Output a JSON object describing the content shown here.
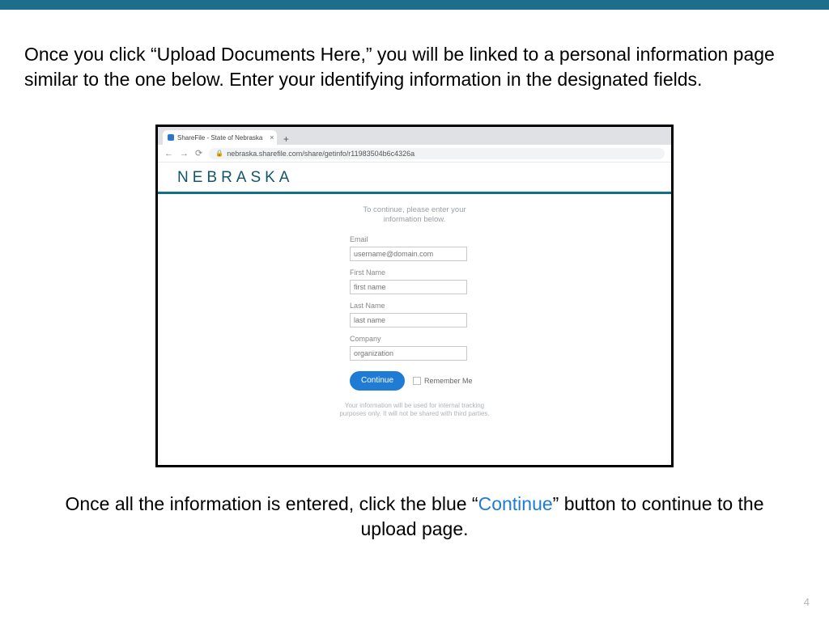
{
  "colors": {
    "accent": "#1d6e8a",
    "button": "#1f7bd4"
  },
  "intro_text": "Once you click “Upload Documents Here,” you will be linked to a personal information page similar to the one below. Enter your identifying information in the designated fields.",
  "browser": {
    "tab_title": "ShareFile - State of Nebraska",
    "url": "nebraska.sharefile.com/share/getinfo/r11983504b6c4326a"
  },
  "site": {
    "logo_text": "NEBRASKA",
    "prompt_line1": "To continue, please enter your",
    "prompt_line2": "information below.",
    "fields": {
      "email": {
        "label": "Email",
        "placeholder": "username@domain.com"
      },
      "first_name": {
        "label": "First Name",
        "placeholder": "first name"
      },
      "last_name": {
        "label": "Last Name",
        "placeholder": "last name"
      },
      "company": {
        "label": "Company",
        "placeholder": "organization"
      }
    },
    "continue_label": "Continue",
    "remember_label": "Remember Me",
    "disclaimer_line1": "Your information will be used for internal tracking",
    "disclaimer_line2": "purposes only. It will not be shared with third parties."
  },
  "outro": {
    "pre": "Once all the information is entered, click the blue “",
    "link": "Continue",
    "post": "” button to continue to the upload page."
  },
  "page_number": "4"
}
